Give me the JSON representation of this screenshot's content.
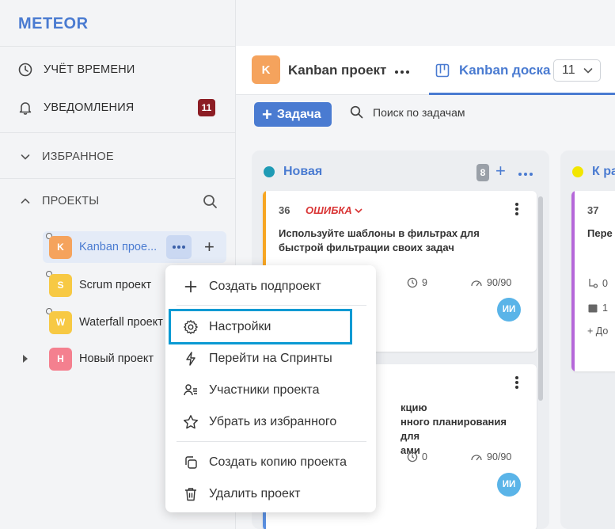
{
  "app": {
    "logo": "METEOR"
  },
  "sidebar": {
    "time_tracking": "УЧЁТ ВРЕМЕНИ",
    "notifications": "УВЕДОМЛЕНИЯ",
    "notifications_count": "11",
    "favorites": "ИЗБРАННОЕ",
    "projects": "ПРОЕКТЫ",
    "project_list": [
      {
        "letter": "K",
        "name": "Kanban прое...",
        "color": "#f5a35d"
      },
      {
        "letter": "S",
        "name": "Scrum проект",
        "color": "#f7c944"
      },
      {
        "letter": "W",
        "name": "Waterfall проект",
        "color": "#f7c944"
      },
      {
        "letter": "Н",
        "name": "Новый проект",
        "color": "#f4808f"
      }
    ]
  },
  "header": {
    "project_letter": "K",
    "project_title": "Kanban проект",
    "tab_label": "Kanban доска",
    "view_count": "11"
  },
  "toolbar": {
    "add_task": "Задача",
    "search_placeholder": "Поиск по задачам"
  },
  "columns": [
    {
      "title": "Новая",
      "count": "8",
      "color": "#1f9bb5"
    },
    {
      "title": "К ра",
      "color": "#f2e600"
    }
  ],
  "cards": {
    "c1": {
      "number": "36",
      "tag": "ОШИБКА",
      "title": "Используйте шаблоны в фильтрах для быстрой фильтрации своих задач",
      "time": "9",
      "progress": "90/90",
      "assignee": "ИИ"
    },
    "c2": {
      "title_l1": "кцию",
      "title_l2": "нного планирования для",
      "title_l3": "ами",
      "time": "0",
      "progress": "90/90",
      "assignee": "ИИ"
    },
    "c3": {
      "number": "37",
      "title": "Пере",
      "subtasks": "0",
      "date": "1",
      "add": "+ До"
    }
  },
  "context_menu": {
    "create_subproject": "Создать подпроект",
    "settings": "Настройки",
    "go_to_sprints": "Перейти на Спринты",
    "members": "Участники проекта",
    "remove_favorite": "Убрать из избранного",
    "copy_project": "Создать копию проекта",
    "delete_project": "Удалить проект"
  }
}
